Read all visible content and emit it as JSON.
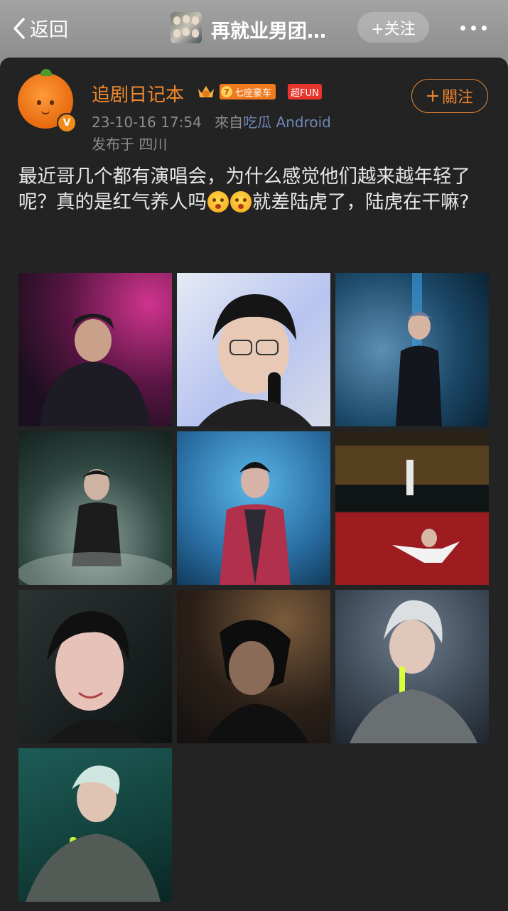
{
  "nav": {
    "back_label": "返回",
    "group_title": "再就业男团…",
    "follow_label": "+关注"
  },
  "post": {
    "username": "追剧日记本",
    "level_badge": "七座豪车",
    "level_number": "7",
    "fun_badge": "超FUN",
    "verified_mark": "V",
    "time": "23-10-16 17:54",
    "source_prefix": "來自",
    "source": "吃瓜 Android",
    "location": "发布于 四川",
    "follow_button": "關注",
    "text_part1": "最近哥几个都有演唱会，为什么感觉他们越来越年轻了呢？真的是红气养人吗",
    "text_part2": "就差陆虎了，陆虎在干嘛?",
    "emoji_name": "smiling-face-icon"
  },
  "images": [
    {
      "name": "photo-1",
      "kind": "singer-pink-stage"
    },
    {
      "name": "photo-2",
      "kind": "singer-glasses-closeup"
    },
    {
      "name": "photo-3",
      "kind": "singer-blue-stage"
    },
    {
      "name": "photo-4",
      "kind": "singer-smoke"
    },
    {
      "name": "photo-5",
      "kind": "singer-red-jacket"
    },
    {
      "name": "photo-6",
      "kind": "stadium-and-red-stage"
    },
    {
      "name": "photo-7",
      "kind": "singer-closeup-smile"
    },
    {
      "name": "photo-8",
      "kind": "singer-dark"
    },
    {
      "name": "photo-9",
      "kind": "singer-silver-hair"
    },
    {
      "name": "photo-10",
      "kind": "singer-green-mic"
    }
  ],
  "colors": {
    "accent": "#f08a2d",
    "card_bg": "#232323",
    "source_link": "#6f86b5"
  }
}
